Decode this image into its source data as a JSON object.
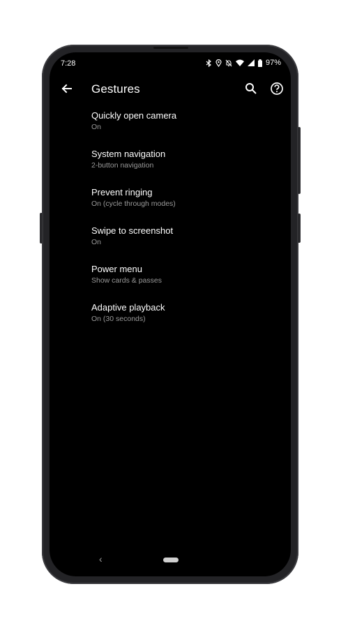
{
  "status_bar": {
    "time": "7:28",
    "battery": "97%",
    "icons": [
      "bluetooth-icon",
      "location-icon",
      "mute-icon",
      "wifi-icon",
      "signal-icon",
      "battery-icon"
    ]
  },
  "app_bar": {
    "title": "Gestures",
    "back_icon": "arrow-back-icon",
    "search_icon": "search-icon",
    "help_icon": "help-icon"
  },
  "settings": [
    {
      "title": "Quickly open camera",
      "summary": "On"
    },
    {
      "title": "System navigation",
      "summary": "2-button navigation"
    },
    {
      "title": "Prevent ringing",
      "summary": "On (cycle through modes)"
    },
    {
      "title": "Swipe to screenshot",
      "summary": "On"
    },
    {
      "title": "Power menu",
      "summary": "Show cards & passes"
    },
    {
      "title": "Adaptive playback",
      "summary": "On (30 seconds)"
    }
  ],
  "nav_bar": {
    "back_glyph": "‹"
  },
  "colors": {
    "screen_bg": "#000000",
    "text_primary": "#ffffff",
    "text_secondary": "#9a9a9a",
    "bezel": "#232326"
  }
}
